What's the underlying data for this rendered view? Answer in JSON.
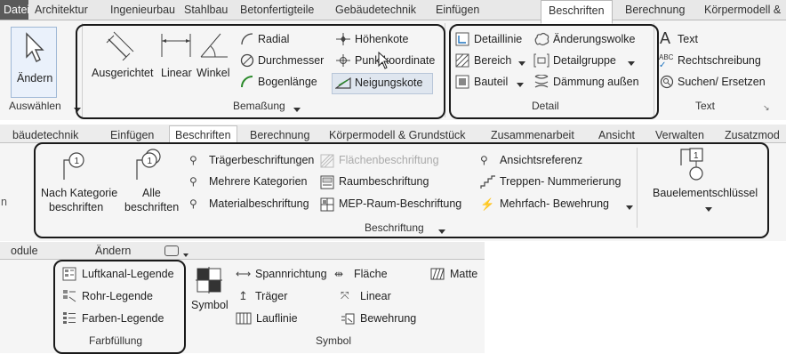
{
  "ribbon1": {
    "tabs": [
      "Datei",
      "Architektur",
      "Ingenieurbau",
      "Stahlbau",
      "Betonfertigteile",
      "Gebäudetechnik",
      "Einfügen",
      "Beschriften",
      "Berechnung",
      "Körpermodell &"
    ],
    "select": {
      "modify_label": "Ändern",
      "panel_label": "Auswählen"
    },
    "dimension": {
      "aligned": "Ausgerichtet",
      "linear": "Linear",
      "angular": "Winkel",
      "radial": "Radial",
      "diameter": "Durchmesser",
      "arc_length": "Bogenlänge",
      "spot_elevation": "Höhenkote",
      "spot_coordinate": "Punktkoordinate",
      "spot_slope": "Neigungskote",
      "panel_label": "Bemaßung"
    },
    "detail": {
      "detail_line": "Detaillinie",
      "region": "Bereich",
      "component": "Bauteil",
      "revision_cloud": "Änderungswolke",
      "detail_group": "Detailgruppe",
      "insulation": "Dämmung außen",
      "panel_label": "Detail"
    },
    "text": {
      "text": "Text",
      "spelling": "Rechtschreibung",
      "find_replace": "Suchen/ Ersetzen",
      "panel_label": "Text"
    }
  },
  "ribbon2": {
    "tabs": [
      "bäudetechnik",
      "Einfügen",
      "Beschriften",
      "Berechnung",
      "Körpermodell & Grundstück",
      "Zusammenarbeit",
      "Ansicht",
      "Verwalten",
      "Zusatzmod"
    ],
    "tag": {
      "by_category_1": "Nach Kategorie",
      "by_category_2": "beschriften",
      "all_1": "Alle",
      "all_2": "beschriften",
      "beam": "Trägerbeschriftungen",
      "area": "Flächenbeschriftung",
      "multi": "Mehrere Kategorien",
      "room": "Raumbeschriftung",
      "material": "Materialbeschriftung",
      "space": "MEP-Raum-Beschriftung",
      "view_ref": "Ansichtsreferenz",
      "stair": "Treppen- Nummerierung",
      "multi_rebar": "Mehrfach- Bewehrung",
      "keynote": "Bauelementschlüssel",
      "panel_label": "Beschriftung"
    },
    "left_edge": "n"
  },
  "ribbon3": {
    "tabs": [
      "odule",
      "Ändern"
    ],
    "color_fill": {
      "duct": "Luftkanal-Legende",
      "pipe": "Rohr-Legende",
      "color": "Farben-Legende",
      "panel_label": "Farbfüllung"
    },
    "symbol": {
      "symbol": "Symbol",
      "span": "Spannrichtung",
      "beam": "Träger",
      "stair_path": "Lauflinie",
      "area": "Fläche",
      "linear": "Linear",
      "rebar": "Bewehrung",
      "matte": "Matte",
      "panel_label": "Symbol"
    }
  },
  "colors": {
    "highlight": "#1a1a1a",
    "accent": "#1e73be",
    "file_tab": "#5a5a5a"
  }
}
